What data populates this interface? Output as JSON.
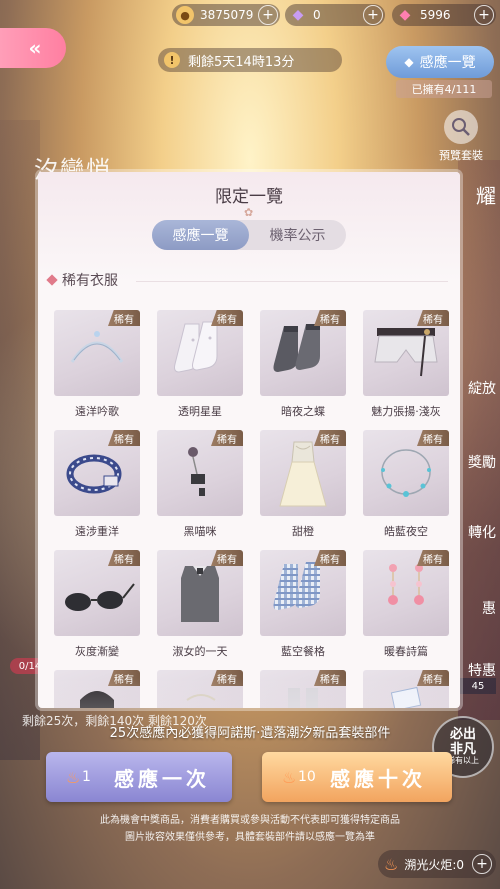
{
  "currency": [
    {
      "icon": "cat-coin-icon",
      "value": "3875079"
    },
    {
      "icon": "purple-gem-icon",
      "value": "0"
    },
    {
      "icon": "pink-diamond-icon",
      "value": "5996"
    }
  ],
  "back_label": "«",
  "timer": {
    "text": "剩餘5天14時13分"
  },
  "summon_list": {
    "label": "感應一覽",
    "owned": "已擁有4/111"
  },
  "preview": {
    "label": "預覽套裝"
  },
  "modal": {
    "title": "限定一覽",
    "tabs": [
      {
        "label": "感應一覽",
        "active": true
      },
      {
        "label": "機率公示",
        "active": false
      }
    ],
    "section_title": "稀有衣服",
    "rarity_label": "稀有",
    "items": [
      {
        "name": "遠洋吟歌",
        "art": "headband"
      },
      {
        "name": "透明星星",
        "art": "socks-white"
      },
      {
        "name": "暗夜之蝶",
        "art": "socks-dark"
      },
      {
        "name": "魅力張揚‧淺灰",
        "art": "shorts"
      },
      {
        "name": "遠涉重洋",
        "art": "bracelet"
      },
      {
        "name": "黑喵咪",
        "art": "earring"
      },
      {
        "name": "甜橙",
        "art": "dress"
      },
      {
        "name": "皓藍夜空",
        "art": "necklace"
      },
      {
        "name": "灰度漸變",
        "art": "glasses"
      },
      {
        "name": "淑女的一天",
        "art": "top"
      },
      {
        "name": "藍空餐格",
        "art": "socks-plaid"
      },
      {
        "name": "暖春詩篇",
        "art": "earrings-pink"
      },
      {
        "name": "",
        "art": "bag"
      },
      {
        "name": "",
        "art": "ring"
      },
      {
        "name": "",
        "art": "cylinder"
      },
      {
        "name": "",
        "art": "cards"
      }
    ]
  },
  "remain_text": "剩餘25次，剩餘140次 剩餘120次",
  "guarantee_text": "25次感應內必獲得阿諾斯‧遺落潮汐新品套裝部件",
  "badge": {
    "line1": "必出",
    "line2": "非凡",
    "line3": "稀有以上"
  },
  "buttons": {
    "one": {
      "count": "1",
      "label": "感應一次"
    },
    "ten": {
      "count": "10",
      "label": "感應十次"
    }
  },
  "notice": [
    "此為機會中獎商品，消費者購買或參與活動不代表即可獲得特定商品",
    "圖片妝容效果僅供參考，具體套裝部件請以感應一覽為準"
  ],
  "torch": {
    "label": "溯光火炬:0"
  },
  "side_left_count": "0/14",
  "side_right_count": "45",
  "side_texts": {
    "logo": "汐變悄",
    "r1": "耀",
    "r2": "綻放",
    "r3": "獎勵",
    "r4": "轉化",
    "r5": "惠",
    "r6": "特惠"
  }
}
